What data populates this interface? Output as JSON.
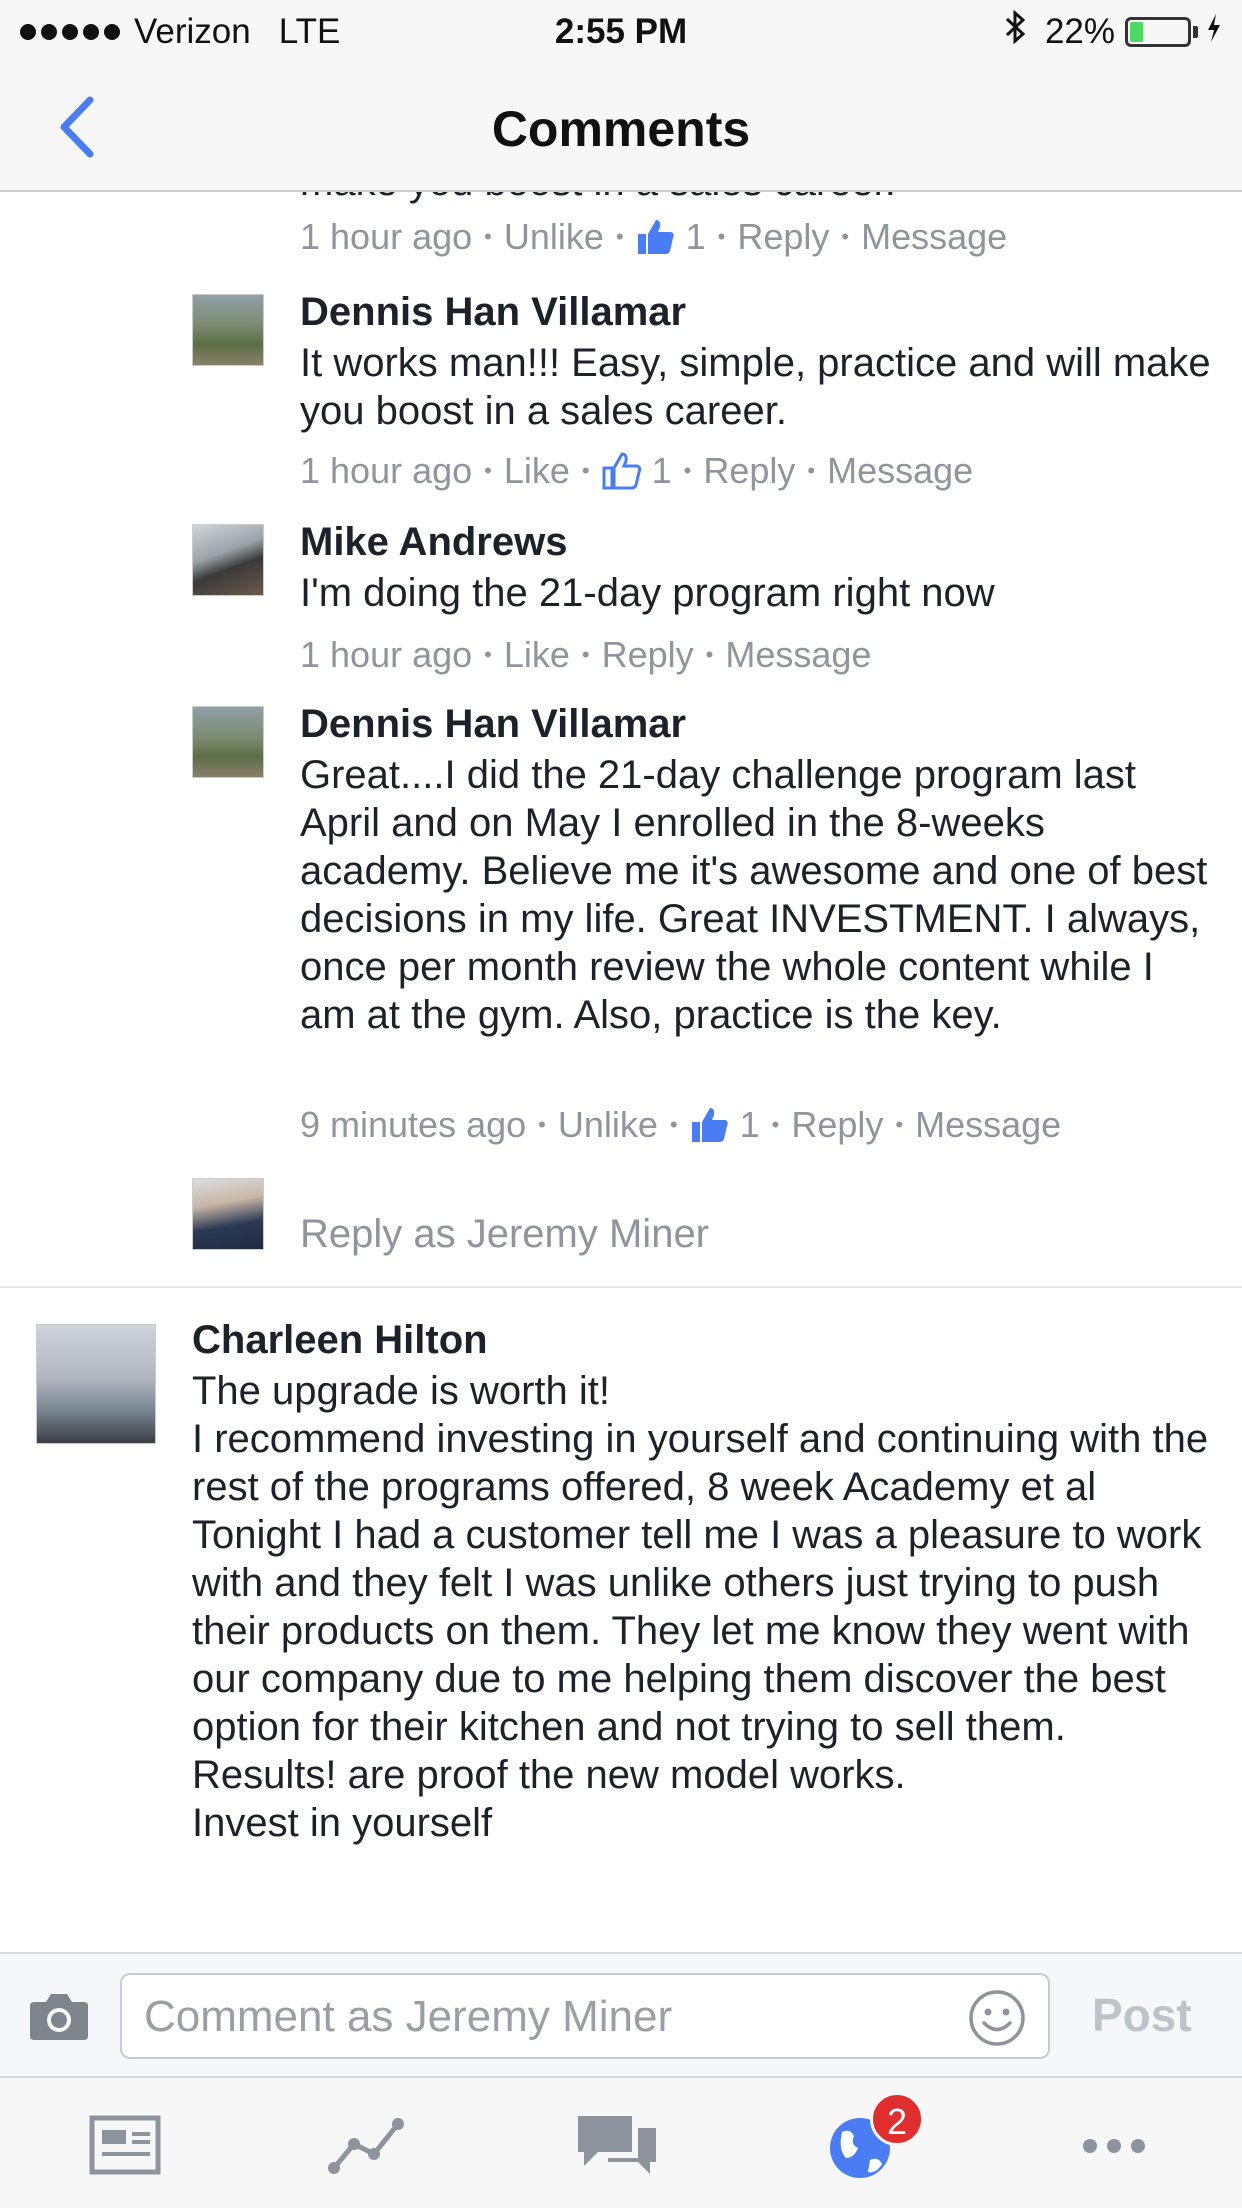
{
  "status_bar": {
    "carrier": "Verizon",
    "network": "LTE",
    "time": "2:55 PM",
    "battery": "22%",
    "battery_level": 0.22
  },
  "nav": {
    "title": "Comments",
    "back_icon": "chevron-left-icon"
  },
  "colors": {
    "accent": "#4a7cf3",
    "meta_gray": "#90949c",
    "badge_red": "#e02d2d"
  },
  "comments": [
    {
      "partial_text": "make you boost in a sales career.",
      "meta": {
        "time": "1 hour ago",
        "action": "Unlike",
        "likes": "1",
        "reply": "Reply",
        "message": "Message"
      }
    },
    {
      "author": "Dennis Han Villamar",
      "text": "It works man!!! Easy, simple, practice and will make you boost in a sales career.",
      "meta": {
        "time": "1 hour ago",
        "action": "Like",
        "likes": "1",
        "reply": "Reply",
        "message": "Message"
      }
    },
    {
      "author": "Mike Andrews",
      "text": "I'm doing the 21-day program right now",
      "meta": {
        "time": "1 hour ago",
        "action": "Like",
        "reply": "Reply",
        "message": "Message"
      }
    },
    {
      "author": "Dennis Han Villamar",
      "text": "Great....I did the 21-day challenge program last April and on May I enrolled in the 8-weeks academy. Believe me it's awesome and one of best decisions in my life. Great INVESTMENT. I always, once per month review the whole content while I am at the gym. Also, practice is the key.",
      "meta": {
        "time": "9 minutes ago",
        "action": "Unlike",
        "likes": "1",
        "reply": "Reply",
        "message": "Message"
      }
    }
  ],
  "reply_as": "Reply as Jeremy Miner",
  "top_comment": {
    "author": "Charleen Hilton",
    "text": "The upgrade is worth it!\nI recommend investing in yourself and continuing with the rest of the programs offered, 8 week Academy et al\nTonight I had a customer tell me I was a pleasure to work with and they felt I was unlike others just trying to push their products on them. They let me know they went with our company due to me helping them discover the best option for their kitchen and not trying to sell them.\nResults! are proof the new model works.\nInvest in yourself"
  },
  "composer": {
    "placeholder": "Comment as Jeremy Miner",
    "post_label": "Post"
  },
  "tab_bar": {
    "notification_count": "2"
  }
}
